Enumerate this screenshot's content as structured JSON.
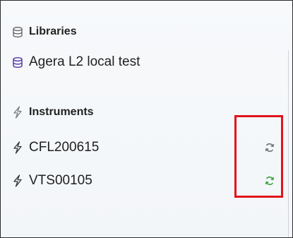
{
  "libraries": {
    "heading": "Libraries",
    "heading_icon": "database-outline-icon",
    "items": [
      {
        "label": "Agera L2 local test",
        "icon": "database-icon",
        "icon_color": "#5b3fa8"
      }
    ]
  },
  "instruments": {
    "heading": "Instruments",
    "heading_icon": "lightning-outline-icon",
    "items": [
      {
        "label": "CFL200615",
        "icon": "lightning-icon",
        "sync_icon": "sync-icon",
        "sync_color": "#6e6e6e"
      },
      {
        "label": "VTS00105",
        "icon": "lightning-icon",
        "sync_icon": "sync-icon",
        "sync_color": "#3aa03a"
      }
    ]
  },
  "colors": {
    "highlight": "#e0141b",
    "text": "#1f1f1f"
  }
}
